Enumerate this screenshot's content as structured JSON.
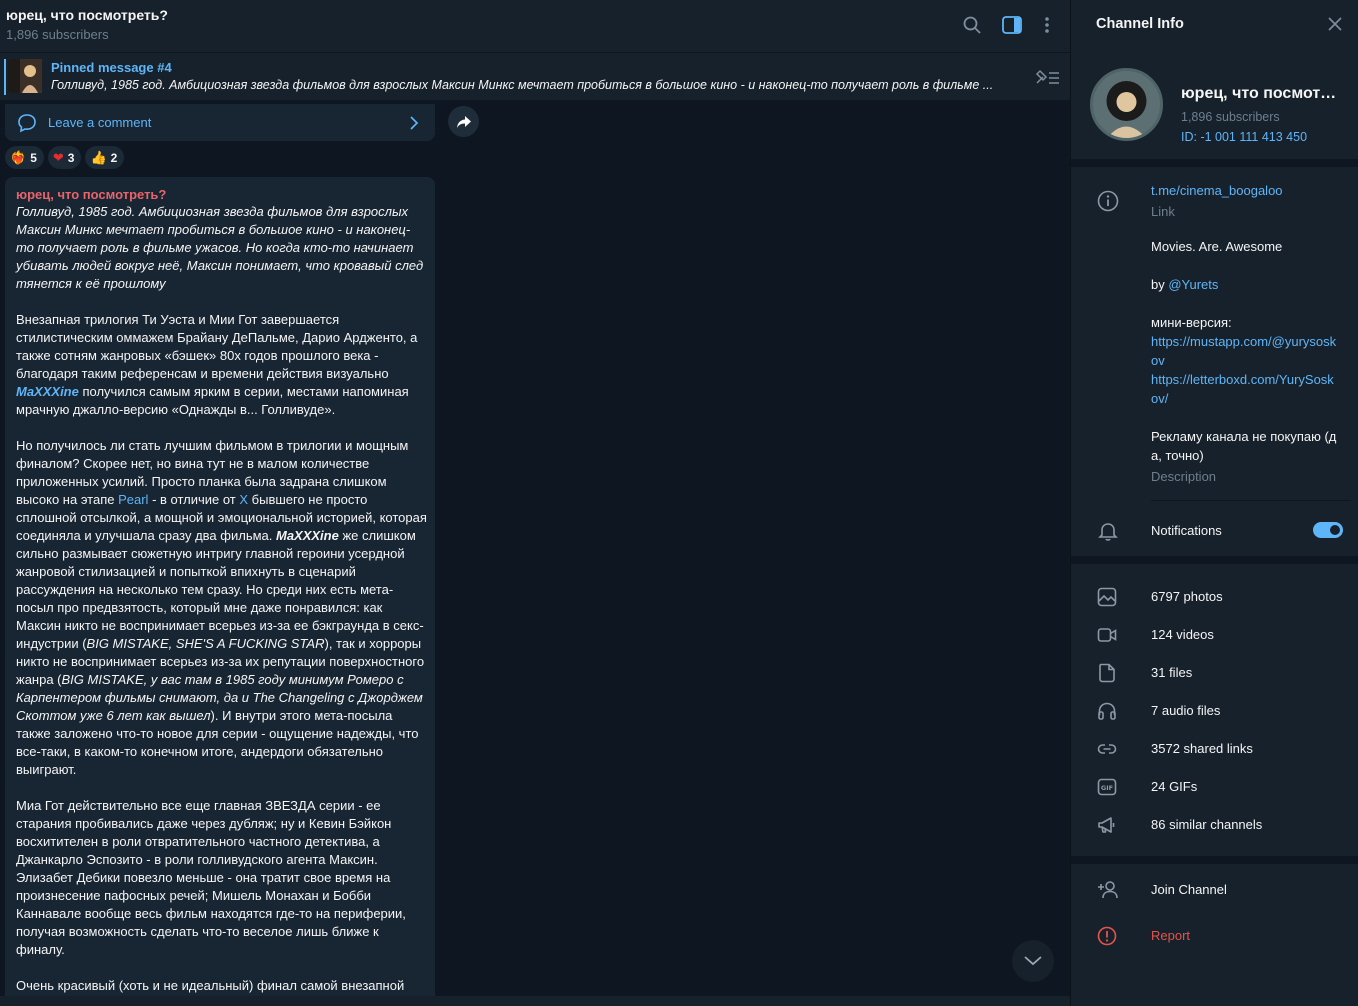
{
  "chat": {
    "title": "юрец, что посмотреть?",
    "subscribers": "1,896 subscribers"
  },
  "pinned": {
    "title": "Pinned message #4",
    "text": "Голливуд, 1985 год. Амбициозная звезда фильмов для взрослых Максин Минкс мечтает пробиться в большое кино - и наконец-то получает роль в фильме ..."
  },
  "comment": {
    "label": "Leave a comment"
  },
  "reactions": [
    {
      "emoji": "❤‍🔥",
      "count": "5"
    },
    {
      "emoji": "❤",
      "count": "3"
    },
    {
      "emoji": "👍",
      "count": "2"
    }
  ],
  "message": {
    "author": "юрец, что посмотреть?",
    "p1": "Голливуд, 1985 год. Амбициозная звезда фильмов для взрослых Максин Минкс мечтает пробиться в большое кино - и наконец-то получает роль в фильме ужасов. Но когда кто-то начинает убивать людей вокруг неё, Максин понимает, что кровавый след тянется к её прошлому",
    "p2a": "Внезапная трилогия Ти Уэста и Мии Гот завершается стилистическим оммажем Брайану ДеПальме, Дарио Ардженто, а также сотням жанровых «бэшек» 80х годов прошлого века - благодаря таким референсам и времени действия визуально ",
    "p2link": "MaXXXine",
    "p2b": " получился самым ярким в серии, местами напоминая мрачную джалло-версию «Однажды в... Голливуде».",
    "p3a": "Но получилось ли стать лучшим фильмом в трилогии и мощным финалом? Скорее нет, но вина тут не в малом количестве приложенных усилий. Просто планка была задрана слишком высоко на этапе ",
    "p3pearl": "Pearl",
    "p3b": " - в отличие от ",
    "p3x": "X",
    "p3c": " бывшего не просто сплошной отсылкой, а мощной и эмоциональной историей, которая соединяла и улучшала сразу два фильма. ",
    "p3bold": "MaXXXine",
    "p3d": " же слишком сильно размывает сюжетную интригу главной героини усердной жанровой стилизацией и попыткой впихнуть в сценарий рассуждения на несколько тем сразу. Но среди них есть мета-посыл про предвзятость, который мне даже понравился: как Максин никто не воспринимает всерьез из-за ее бэкграунда в секс-индустрии (",
    "p3it1": "BIG MISTAKE, SHE'S A FUCKING STAR",
    "p3e": "), так и хорроры никто не воспринимает всерьез из-за их репутации поверхностного жанра (",
    "p3it2": "BIG MISTAKE, у вас там в 1985 году минимум Ромеро с Карпентером фильмы снимают, да и The Changeling с Джорджем Скоттом уже 6 лет как вышел",
    "p3f": "). И внутри этого мета-посыла также заложено что-то новое для серии - ощущение надежды, что все-таки, в каком-то конечном итоге, андердоги обязательно выиграют.",
    "p4": "Миа Гот действительно все еще главная ЗВЕЗДА серии - ее старания пробивались даже через дубляж; ну и Кевин Бэйкон восхитителен в роли отвратительного частного детектива, а Джанкарло Эспозито - в роли голливудского агента Максин. Элизабет Дебики повезло меньше - она тратит свое время на произнесение пафосных речей; Мишель Монахан и Бобби Каннавале вообще весь фильм находятся где-то на периферии, получая возможность сделать что-то веселое лишь ближе к финалу.",
    "p5": "Очень красивый (хоть и не идеальный) финал самой внезапной"
  },
  "panel": {
    "header": "Channel Info",
    "name": "юрец, что посмотреть?",
    "subscribers": "1,896 subscribers",
    "id": "ID: -1 001 111 413 450",
    "link": "t.me/cinema_boogaloo",
    "link_caption": "Link",
    "desc1": "Movies. Are. Awesome",
    "desc_by": "by ",
    "desc_handle": "@Yurets",
    "desc_mini": "мини-версия:",
    "desc_url1": "https://mustapp.com/@yurysoskov",
    "desc_url2": "https://letterboxd.com/YurySoskov/",
    "desc_ads": "Рекламу канала не покупаю (да, точно)",
    "desc_caption": "Description",
    "notifications": "Notifications",
    "notifications_on": true,
    "media": [
      {
        "icon": "photo-icon",
        "label": "6797 photos"
      },
      {
        "icon": "video-icon",
        "label": "124 videos"
      },
      {
        "icon": "file-icon",
        "label": "31 files"
      },
      {
        "icon": "headphones-icon",
        "label": "7 audio files"
      },
      {
        "icon": "link-icon",
        "label": "3572 shared links"
      },
      {
        "icon": "gif-icon",
        "label": "24 GIFs"
      },
      {
        "icon": "megaphone-icon",
        "label": "86 similar channels"
      }
    ],
    "join": "Join Channel",
    "report": "Report"
  }
}
